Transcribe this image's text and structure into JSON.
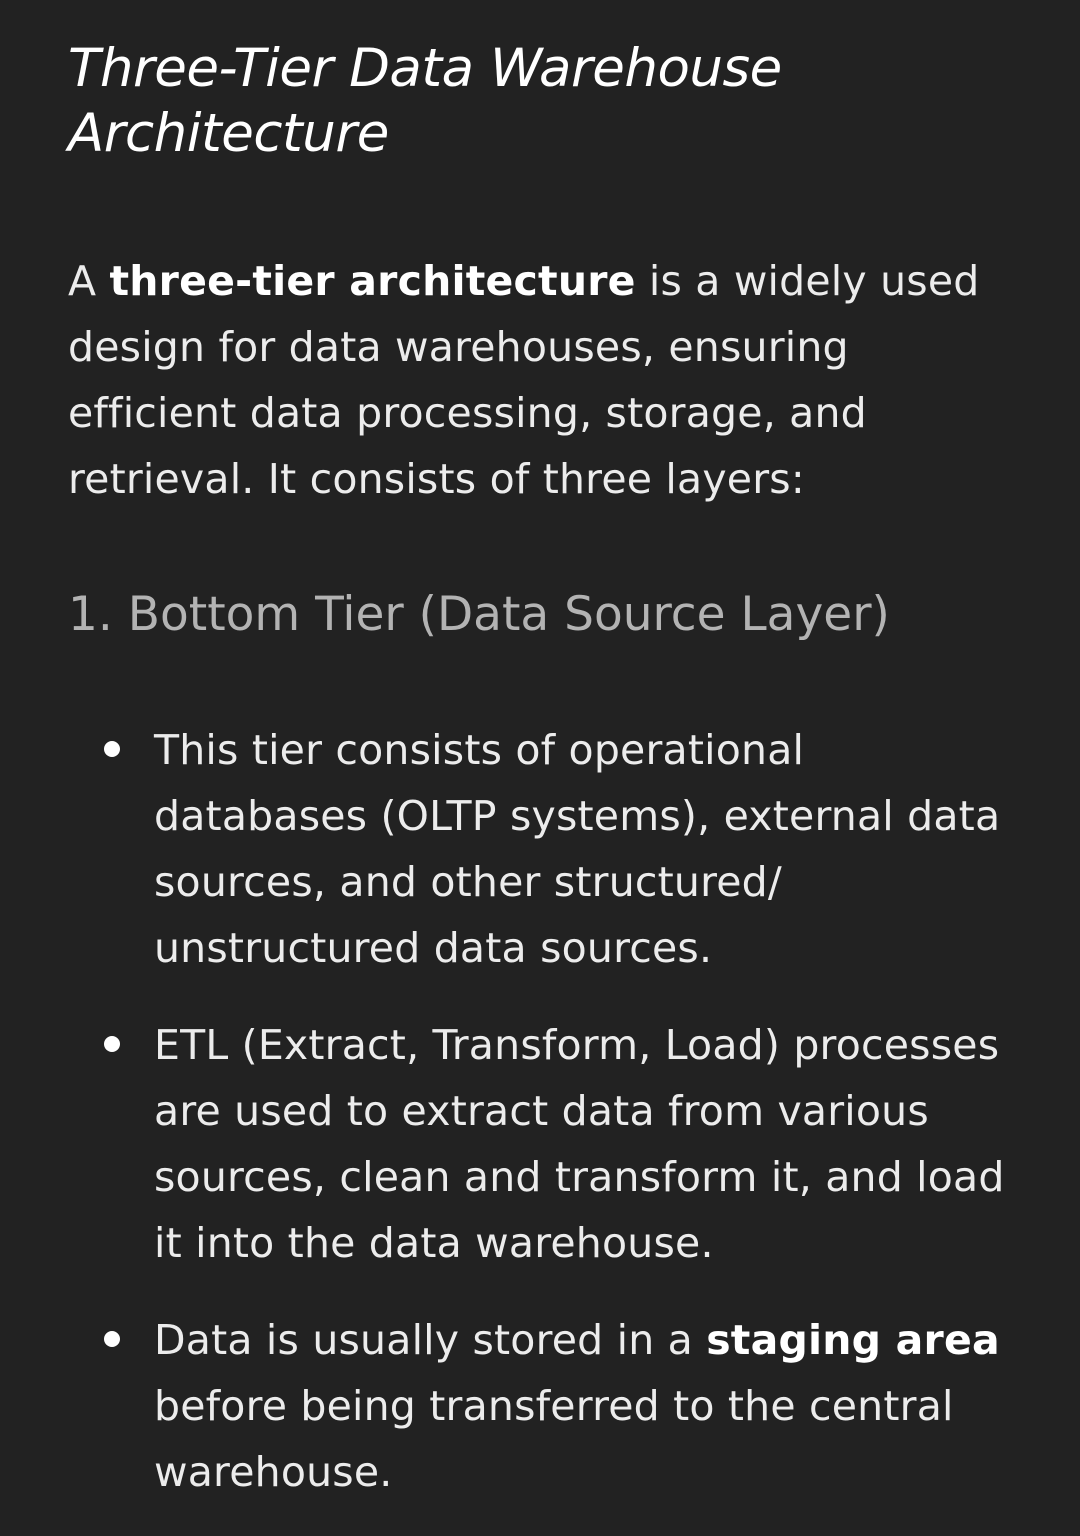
{
  "title": "Three-Tier Data Warehouse Architecture",
  "intro": {
    "prefix": "A ",
    "emphasis": "three-tier architecture",
    "suffix": " is a widely used design for data warehouses, ensuring efficient data processing, storage, and retrieval. It consists of three layers:"
  },
  "section": {
    "heading": "1. Bottom Tier (Data Source Layer)",
    "bullets": [
      {
        "before": "This tier consists of operational databases (OLTP systems), external data sources, and other structured/ unstructured data sources.",
        "emphasis": "",
        "after": ""
      },
      {
        "before": "ETL (Extract, Transform, Load) processes are used to extract data from various sources, clean and transform it, and load it into the data warehouse.",
        "emphasis": "",
        "after": ""
      },
      {
        "before": "Data is usually stored in a ",
        "emphasis": "staging area",
        "after": " before being transferred to the central warehouse."
      }
    ]
  }
}
